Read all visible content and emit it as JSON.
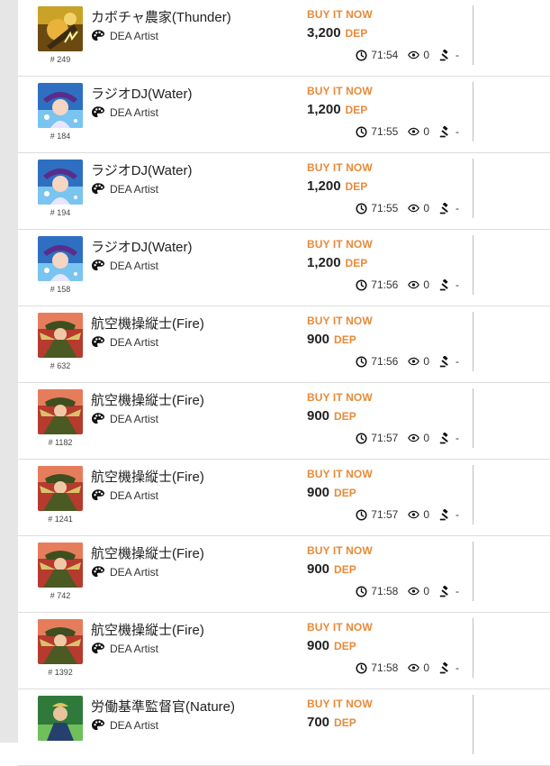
{
  "listings": [
    {
      "name": "カボチャ農家(Thunder)",
      "artist": "DEA Artist",
      "serial": "# 249",
      "buy_label": "BUY IT NOW",
      "price": "3,200",
      "currency": "DEP",
      "time": "71:54",
      "views": "0",
      "bids": "-",
      "art": "thunder"
    },
    {
      "name": "ラジオDJ(Water)",
      "artist": "DEA Artist",
      "serial": "# 184",
      "buy_label": "BUY IT NOW",
      "price": "1,200",
      "currency": "DEP",
      "time": "71:55",
      "views": "0",
      "bids": "-",
      "art": "water"
    },
    {
      "name": "ラジオDJ(Water)",
      "artist": "DEA Artist",
      "serial": "# 194",
      "buy_label": "BUY IT NOW",
      "price": "1,200",
      "currency": "DEP",
      "time": "71:55",
      "views": "0",
      "bids": "-",
      "art": "water"
    },
    {
      "name": "ラジオDJ(Water)",
      "artist": "DEA Artist",
      "serial": "# 158",
      "buy_label": "BUY IT NOW",
      "price": "1,200",
      "currency": "DEP",
      "time": "71:56",
      "views": "0",
      "bids": "-",
      "art": "water"
    },
    {
      "name": "航空機操縦士(Fire)",
      "artist": "DEA Artist",
      "serial": "# 632",
      "buy_label": "BUY IT NOW",
      "price": "900",
      "currency": "DEP",
      "time": "71:56",
      "views": "0",
      "bids": "-",
      "art": "fire"
    },
    {
      "name": "航空機操縦士(Fire)",
      "artist": "DEA Artist",
      "serial": "# 1182",
      "buy_label": "BUY IT NOW",
      "price": "900",
      "currency": "DEP",
      "time": "71:57",
      "views": "0",
      "bids": "-",
      "art": "fire"
    },
    {
      "name": "航空機操縦士(Fire)",
      "artist": "DEA Artist",
      "serial": "# 1241",
      "buy_label": "BUY IT NOW",
      "price": "900",
      "currency": "DEP",
      "time": "71:57",
      "views": "0",
      "bids": "-",
      "art": "fire"
    },
    {
      "name": "航空機操縦士(Fire)",
      "artist": "DEA Artist",
      "serial": "# 742",
      "buy_label": "BUY IT NOW",
      "price": "900",
      "currency": "DEP",
      "time": "71:58",
      "views": "0",
      "bids": "-",
      "art": "fire"
    },
    {
      "name": "航空機操縦士(Fire)",
      "artist": "DEA Artist",
      "serial": "# 1392",
      "buy_label": "BUY IT NOW",
      "price": "900",
      "currency": "DEP",
      "time": "71:58",
      "views": "0",
      "bids": "-",
      "art": "fire"
    },
    {
      "name": "労働基準監督官(Nature)",
      "artist": "DEA Artist",
      "serial": "",
      "buy_label": "BUY IT NOW",
      "price": "700",
      "currency": "DEP",
      "time": "",
      "views": "",
      "bids": "",
      "art": "nature"
    }
  ],
  "colors": {
    "accent": "#e88a3a",
    "gutter": "#e6e6e6",
    "divider": "#bdbdbd"
  },
  "icons": {
    "artist": "palette-icon",
    "time": "clock-icon",
    "views": "eye-icon",
    "bids": "gavel-icon"
  }
}
